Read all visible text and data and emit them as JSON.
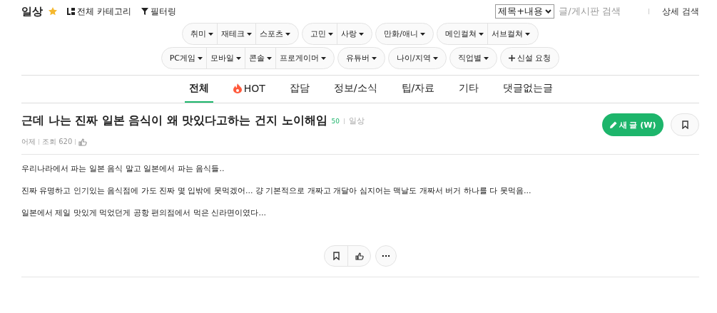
{
  "header": {
    "board": "일상",
    "favorite": true,
    "all_categories": "전체 카테고리",
    "filter": "필터링"
  },
  "search": {
    "scope": "제목+내용",
    "placeholder": "글/게시판 검색",
    "advanced": "상세 검색"
  },
  "category_rows": [
    [
      {
        "items": [
          "취미",
          "재테크",
          "스포츠"
        ]
      },
      {
        "items": [
          "고민",
          "사랑"
        ]
      },
      {
        "items": [
          "만화/애니"
        ]
      },
      {
        "items": [
          "메인컬쳐",
          "서브컬쳐"
        ]
      }
    ],
    [
      {
        "items": [
          "PC게임",
          "모바일",
          "콘솔",
          "프로게이머"
        ]
      },
      {
        "items": [
          "유튜버"
        ]
      },
      {
        "items": [
          "나이/지역"
        ]
      },
      {
        "items": [
          "직업별"
        ]
      },
      {
        "items": [
          "신설 요청"
        ],
        "kind": "request"
      }
    ]
  ],
  "tabs": [
    {
      "label": "전체",
      "selected": true
    },
    {
      "label": "HOT",
      "selected": false,
      "kind": "hot"
    },
    {
      "label": "잡담",
      "selected": false
    },
    {
      "label": "정보/소식",
      "selected": false
    },
    {
      "label": "팁/자료",
      "selected": false
    },
    {
      "label": "기타",
      "selected": false
    },
    {
      "label": "댓글없는글",
      "selected": false
    }
  ],
  "post": {
    "title": "근데 나는 진짜 일본 음식이 왜 맛있다고하는 건지 노이해임",
    "points": "50",
    "board": "일상",
    "date": "어제",
    "views": "조회 620",
    "paragraphs": [
      "우리나라에서 파는 일본 음식 말고 일본에서 파는 음식들..",
      "진짜 유명하고 인기있는 음식점에 가도 진짜 몇 입밖에 못먹겠어... 걍 기본적으로 개짜고 개달아 심지어는 맥날도 개짜서 버거 하나를 다 못먹음...",
      "일본에서 제일 맛있게 먹었던게 공항 편의점에서 먹은 신라면이였다..."
    ]
  },
  "new_post_button": "새 글 (W)",
  "more_button": "···"
}
